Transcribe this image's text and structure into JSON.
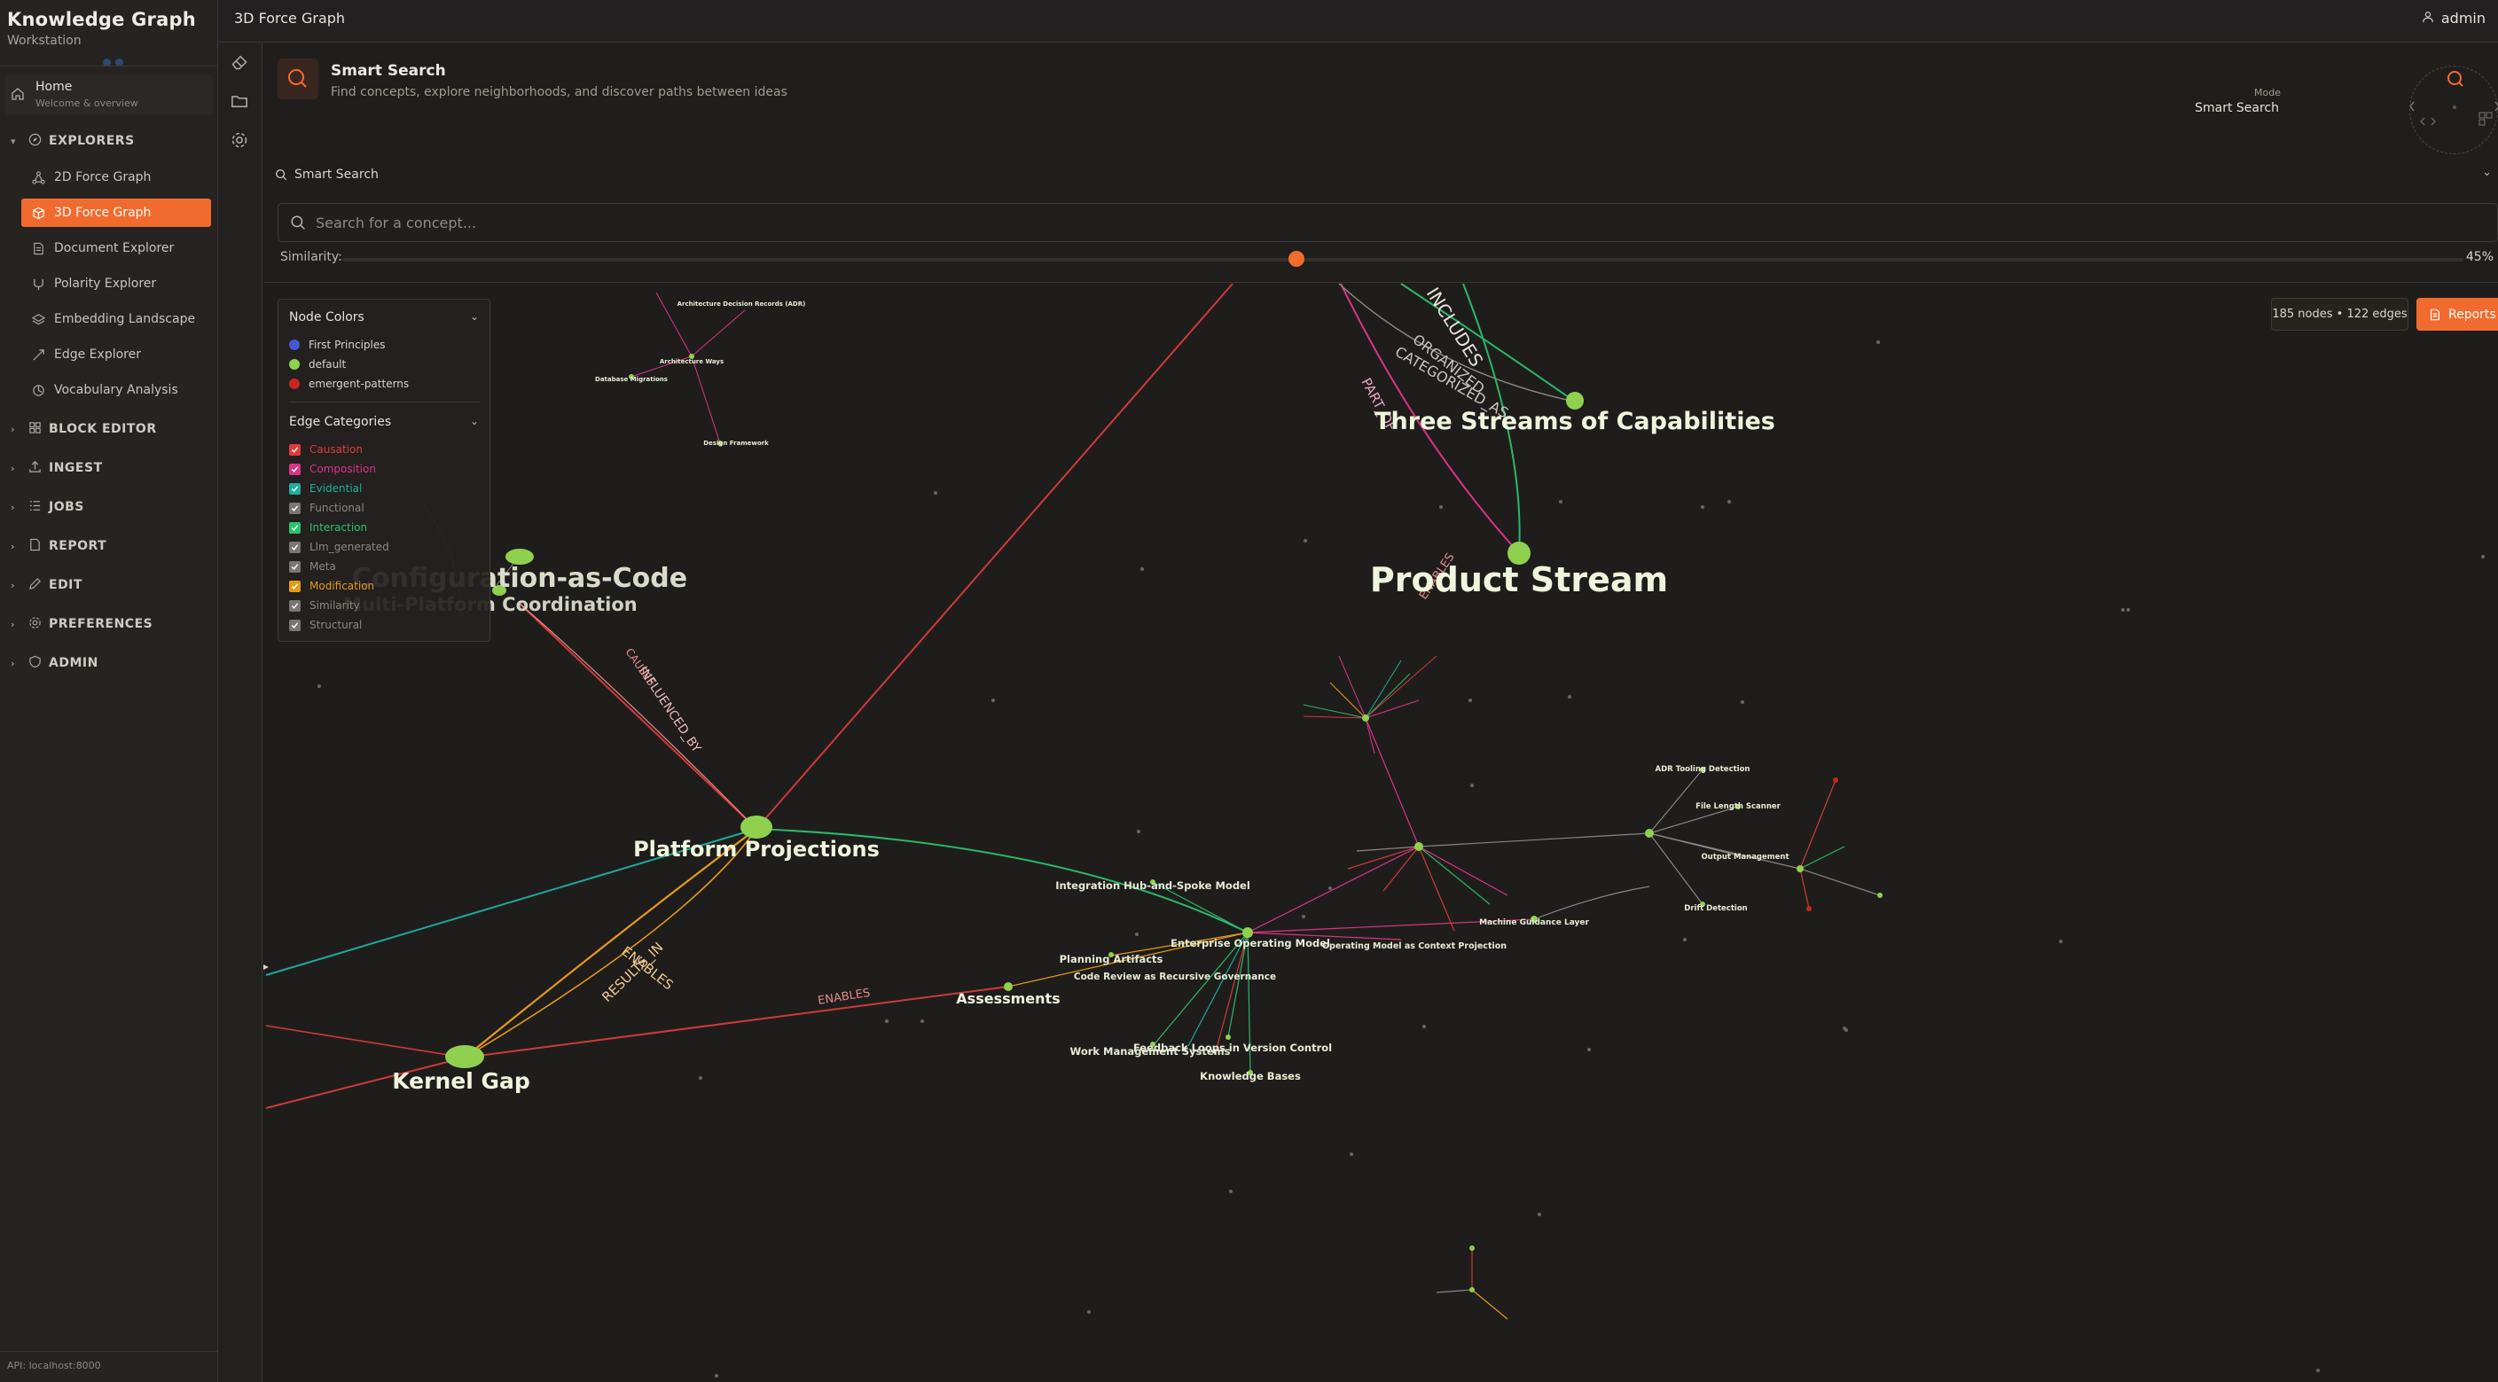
{
  "app": {
    "title": "Knowledge Graph",
    "subtitle": "Workstation",
    "api": "API: localhost:8000"
  },
  "topbar": {
    "title": "3D Force Graph",
    "user": "admin"
  },
  "sidebar": {
    "home": {
      "label": "Home",
      "sub": "Welcome & overview"
    },
    "sections": [
      {
        "label": "EXPLORERS",
        "expanded": true
      },
      {
        "label": "BLOCK EDITOR",
        "expanded": false
      },
      {
        "label": "INGEST",
        "expanded": false
      },
      {
        "label": "JOBS",
        "expanded": false
      },
      {
        "label": "REPORT",
        "expanded": false
      },
      {
        "label": "EDIT",
        "expanded": false
      },
      {
        "label": "PREFERENCES",
        "expanded": false
      },
      {
        "label": "ADMIN",
        "expanded": false
      }
    ],
    "explorers": [
      {
        "label": "2D Force Graph",
        "icon": "graph-icon",
        "active": false
      },
      {
        "label": "3D Force Graph",
        "icon": "cube-icon",
        "active": true
      },
      {
        "label": "Document Explorer",
        "icon": "document-icon",
        "active": false
      },
      {
        "label": "Polarity Explorer",
        "icon": "polarity-icon",
        "active": false
      },
      {
        "label": "Embedding Landscape",
        "icon": "layers-icon",
        "active": false
      },
      {
        "label": "Edge Explorer",
        "icon": "edge-icon",
        "active": false
      },
      {
        "label": "Vocabulary Analysis",
        "icon": "vocabulary-icon",
        "active": false
      }
    ]
  },
  "header": {
    "title": "Smart Search",
    "description": "Find concepts, explore neighborhoods, and discover paths between ideas",
    "mode_label": "Mode",
    "mode_value": "Smart Search"
  },
  "search": {
    "section_label": "Smart Search",
    "placeholder": "Search for a concept...",
    "similarity_label": "Similarity:",
    "similarity_value": "45%",
    "similarity_fraction": 0.45
  },
  "stats": {
    "label": "185 nodes • 122 edges",
    "reports_label": "Reports"
  },
  "legend": {
    "node_colors_title": "Node Colors",
    "node_colors": [
      {
        "label": "First Principles",
        "color": "#4a57d4"
      },
      {
        "label": "default",
        "color": "#8fd14f"
      },
      {
        "label": "emergent-patterns",
        "color": "#c8261e"
      }
    ],
    "edge_title": "Edge Categories",
    "edge_categories": [
      {
        "label": "Causation",
        "color": "#e23b3b"
      },
      {
        "label": "Composition",
        "color": "#d9348a"
      },
      {
        "label": "Evidential",
        "color": "#1fae9f"
      },
      {
        "label": "Functional",
        "color": "#7a7772"
      },
      {
        "label": "Interaction",
        "color": "#2ac46b"
      },
      {
        "label": "Llm_generated",
        "color": "#7a7772"
      },
      {
        "label": "Meta",
        "color": "#7a7772"
      },
      {
        "label": "Modification",
        "color": "#e69a1c"
      },
      {
        "label": "Similarity",
        "color": "#7a7772"
      },
      {
        "label": "Structural",
        "color": "#7a7772"
      }
    ]
  },
  "graph": {
    "big_labels": {
      "three_streams": "Three Streams of Capabilities",
      "product_stream": "Product Stream",
      "config_as_code": "Configuration-as-Code",
      "multi_platform": "Multi-Platform Coordination",
      "platform_projections": "Platform Projections",
      "kernel_gap": "Kernel Gap",
      "assessments": "Assessments"
    },
    "medium_labels": {
      "integration_hub": "Integration Hub-and-Spoke Model",
      "enterprise_op": "Enterprise Operating Model",
      "planning": "Planning Artifacts",
      "code_review": "Code Review as Recursive Governance",
      "work_mgmt": "Work Management Systems",
      "feedback_loops": "Feedback Loops in Version Control",
      "knowledge_bases": "Knowledge Bases",
      "op_model": "Operating Model as Context Projection",
      "machine_layer": "Machine Guidance Layer",
      "adr_tooling": "ADR Tooling Detection",
      "file_length": "File Length Scanner",
      "output_mgmt": "Output Management",
      "drift_detection": "Drift Detection",
      "adr_records": "Architecture Decision Records (ADR)",
      "arch_ways": "Architecture Ways",
      "db_migrations": "Database Migrations",
      "design_framework": "Design Framework"
    },
    "edge_labels": {
      "includes": "INCLUDES",
      "organized": "ORGANIZED",
      "categorized_as": "CATEGORIZED_AS",
      "part_of": "PART_OF",
      "enables": "ENABLES",
      "enables2": "ENABLES",
      "enables3": "ENABLES",
      "results_in": "RESULTS_IN",
      "causes": "CAUSES",
      "influenced_by": "INFLUENCED_BY"
    }
  }
}
